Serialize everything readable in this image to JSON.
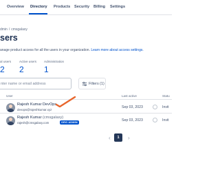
{
  "nav": {
    "items": [
      {
        "label": "Overview"
      },
      {
        "label": "Directory"
      },
      {
        "label": "Products"
      },
      {
        "label": "Security"
      },
      {
        "label": "Billing"
      },
      {
        "label": "Settings"
      }
    ],
    "active": "Directory"
  },
  "breadcrumb": {
    "items": [
      "dmin",
      "cmsgalaxy"
    ]
  },
  "page": {
    "title": "sers",
    "description": "anage product access for all the users in your organization.",
    "description_link": "Learn more about access settings."
  },
  "stats": [
    {
      "label": "al users",
      "value": "2"
    },
    {
      "label": "Active users",
      "value": "2"
    },
    {
      "label": "Administration",
      "value": "1"
    }
  ],
  "search": {
    "placeholder": "nter name or email address"
  },
  "filter": {
    "label": "Filters (1)",
    "icon": "filter-icon"
  },
  "table": {
    "columns": {
      "user": "User",
      "last_active": "Last active",
      "status": "Statu"
    },
    "rows": [
      {
        "name": "Rajesh Kumar DevOps",
        "handle": "",
        "email": "devops@rajeshkumar.xyz",
        "badge": "",
        "last_active": "Sep 03, 2023",
        "status": "Invit"
      },
      {
        "name": "Rajesh Kumar",
        "handle": "(cmsgalaxy)",
        "email": "rajesh@cmsgalaxy.com",
        "badge": "ORG ADMIN",
        "last_active": "Sep 03, 2023",
        "status": "Invit"
      }
    ]
  },
  "pagination": {
    "current": "1",
    "prev_icon": "chevron-left-icon",
    "next_icon": "chevron-right-icon"
  },
  "colors": {
    "accent": "#0052cc",
    "annotation": "#e8652b",
    "nav_active": "#0052cc"
  }
}
